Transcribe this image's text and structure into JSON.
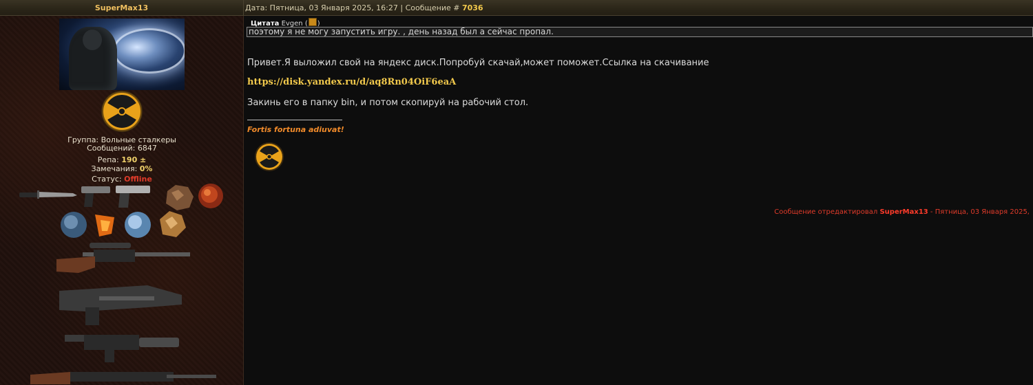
{
  "header": {
    "author": "SuperMax13",
    "meta_prefix": "Дата: Пятница, 03 Января 2025, 16:27 | Сообщение # ",
    "message_number": "7036"
  },
  "sidebar": {
    "group": "Группа: Вольные сталкеры",
    "messages": "Сообщений: 6847",
    "rep_label": "Репа: ",
    "rep_value": "190 ±",
    "warnings_label": "Замечания: ",
    "warnings_value": "0%",
    "status_label": "Статус: ",
    "status_value": "Offline"
  },
  "post": {
    "quote_label": "Цитата",
    "quote_author": "Evgen",
    "quote_text": "поэтому я не могу запустить игру. , день назад был а сейчас пропал.",
    "paragraph1": "Привет.Я выложил свой на яндекс диск.Попробуй скачай,может поможет.Ссылка на скачивание",
    "link": "https://disk.yandex.ru/d/aq8Rn04OiF6eaA",
    "paragraph2": "Закинь его в папку bin, и потом скопируй на рабочий стол.",
    "signature_motto": "Fortis fortuna adiuvat!",
    "edited_prefix": "Сообщение отредактировал ",
    "edited_user": "SuperMax13",
    "edited_suffix": " - Пятница, 03 Января 2025,"
  },
  "colors": {
    "accent": "#f2c94c",
    "offline": "#e03b2a",
    "motto": "#f08a2a"
  }
}
